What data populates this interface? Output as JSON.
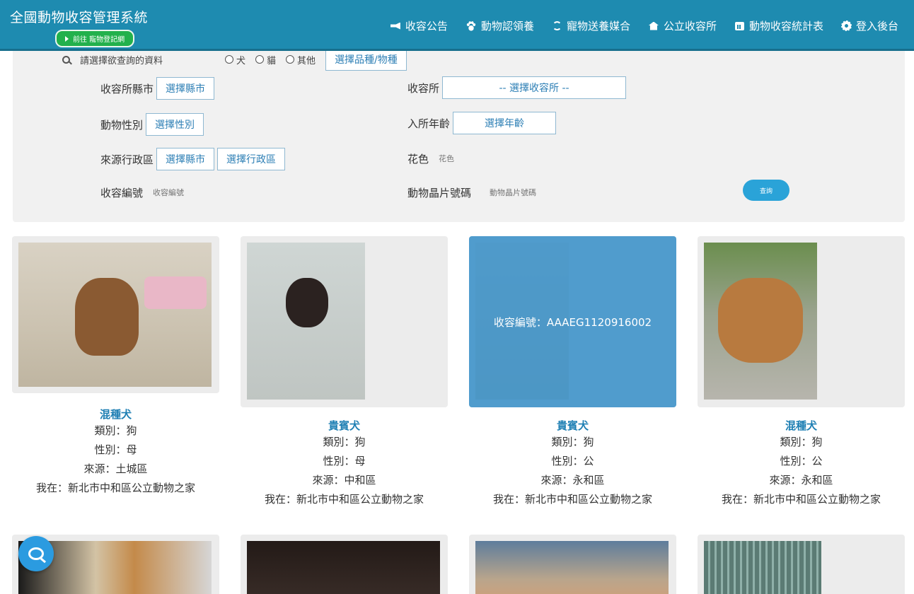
{
  "header": {
    "title": "全國動物收容管理系統",
    "register_btn": "前往 寵物登記網",
    "nav": [
      {
        "label": "收容公告",
        "icon": "bullhorn-icon"
      },
      {
        "label": "動物認領養",
        "icon": "paw-icon"
      },
      {
        "label": "寵物送養媒合",
        "icon": "sync-icon"
      },
      {
        "label": "公立收容所",
        "icon": "home-icon"
      },
      {
        "label": "動物收容統計表",
        "icon": "chart-icon"
      },
      {
        "label": "登入後台",
        "icon": "gear-icon"
      }
    ]
  },
  "filter": {
    "partial_prompt": "請選擇欲查詢的資料",
    "types": [
      "犬",
      "貓",
      "其他"
    ],
    "breed_btn": "選擇品種/物種",
    "shelter_city_label": "收容所縣市",
    "shelter_city_btn": "選擇縣市",
    "shelter_label": "收容所",
    "shelter_btn": "-- 選擇收容所 --",
    "sex_label": "動物性別",
    "sex_btn": "選擇性別",
    "age_label": "入所年齡",
    "age_btn": "選擇年齡",
    "source_label": "來源行政區",
    "source_city_btn": "選擇縣市",
    "source_district_btn": "選擇行政區",
    "color_label": "花色",
    "color_placeholder": "花色",
    "shelter_no_label": "收容編號",
    "shelter_no_placeholder": "收容編號",
    "chip_label": "動物晶片號碼",
    "chip_placeholder": "動物晶片號碼",
    "query_btn": "查詢"
  },
  "animals": [
    {
      "breed": "混種犬",
      "kind": "類別：狗",
      "sex": "性別：母",
      "source": "來源：土城區",
      "location": "我在：新北市中和區公立動物之家"
    },
    {
      "breed": "貴賓犬",
      "kind": "類別：狗",
      "sex": "性別：母",
      "source": "來源：中和區",
      "location": "我在：新北市中和區公立動物之家"
    },
    {
      "breed": "貴賓犬",
      "kind": "類別：狗",
      "sex": "性別：公",
      "source": "來源：永和區",
      "location": "我在：新北市中和區公立動物之家",
      "hover_id": "收容編號：AAAEG1120916002"
    },
    {
      "breed": "混種犬",
      "kind": "類別：狗",
      "sex": "性別：公",
      "source": "來源：永和區",
      "location": "我在：新北市中和區公立動物之家"
    }
  ],
  "colors": {
    "header": "#1e8bb0",
    "accent": "#2aa3d8",
    "green_btn": "#22b14c",
    "breed_text": "#1e7fb3"
  }
}
